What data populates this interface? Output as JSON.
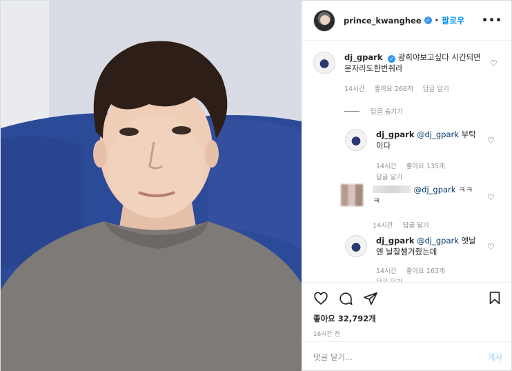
{
  "header": {
    "username": "prince_kwanghee",
    "follow_label": "팔로우",
    "separator": "•",
    "more_label": "•••"
  },
  "comments": [
    {
      "username": "dj_gpark",
      "verified": true,
      "text": "광희야보고싶다 시간되면 문자라도한번줘라",
      "time": "14시간",
      "likes": "좋아요 266개",
      "reply": "답글 달기"
    }
  ],
  "hide_replies_label": "답글 숨기기",
  "replies": [
    {
      "username": "dj_gpark",
      "mention": "@dj_gpark",
      "text": "부탁이다",
      "time": "14시간",
      "likes": "좋아요 135개",
      "reply": "답글 달기"
    },
    {
      "username": "",
      "mention": "@dj_gpark",
      "text": "ㅋㅋㅋ",
      "time": "14시간",
      "reply": "답글 달기"
    },
    {
      "username": "dj_gpark",
      "mention": "@dj_gpark",
      "text": "옛날엔 날잘챙겨줬는데",
      "time": "14시간",
      "likes": "좋아요 163개",
      "reply": "답글 달기"
    }
  ],
  "actions": {
    "likes": "좋아요 32,792개",
    "time": "16시간 전"
  },
  "add_comment": {
    "placeholder": "댓글 달기...",
    "post_label": "게시"
  },
  "icons": [
    "heart-icon",
    "comment-icon",
    "share-icon",
    "bookmark-icon",
    "verified-icon",
    "more-icon"
  ],
  "colors": {
    "link": "#0095f6",
    "verified": "#3897f0",
    "muted": "#8e8e8e",
    "mention": "#00376b"
  }
}
